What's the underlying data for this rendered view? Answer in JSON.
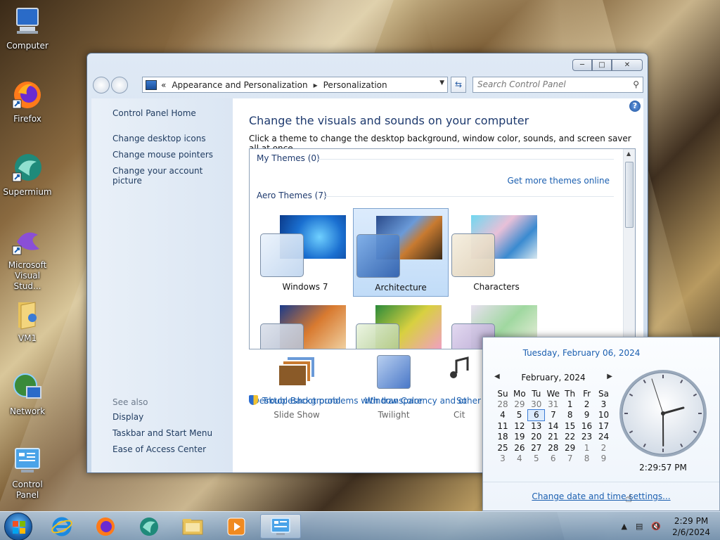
{
  "desktop": {
    "icons": [
      {
        "label": "Computer"
      },
      {
        "label": "Firefox"
      },
      {
        "label": "Supermium"
      },
      {
        "label": "Microsoft Visual Stud..."
      },
      {
        "label": "VM1"
      },
      {
        "label": "Network"
      },
      {
        "label": "Control Panel"
      }
    ]
  },
  "window": {
    "breadcrumb_prefix": "«",
    "breadcrumb": [
      "Appearance and Personalization",
      "Personalization"
    ],
    "search_placeholder": "Search Control Panel",
    "help": "?",
    "left_links": [
      "Control Panel Home",
      "Change desktop icons",
      "Change mouse pointers",
      "Change your account picture"
    ],
    "see_also_label": "See also",
    "see_also": [
      "Display",
      "Taskbar and Start Menu",
      "Ease of Access Center"
    ],
    "heading": "Change the visuals and sounds on your computer",
    "subheading": "Click a theme to change the desktop background, window color, sounds, and screen saver all at once.",
    "my_themes": "My Themes (0)",
    "get_more": "Get more themes online",
    "aero_themes": "Aero Themes (7)",
    "themes": [
      {
        "name": "Windows 7",
        "selected": false
      },
      {
        "name": "Architecture",
        "selected": true
      },
      {
        "name": "Characters",
        "selected": false
      }
    ],
    "bottom": [
      {
        "label": "Desktop Background",
        "sub": "Slide Show"
      },
      {
        "label": "Window Color",
        "sub": "Twilight"
      },
      {
        "label": "So",
        "sub": "Cit"
      }
    ],
    "troubleshoot": "Troubleshoot problems with transparency and other Aero e"
  },
  "flyout": {
    "long_date": "Tuesday, February 06, 2024",
    "month_label": "February, 2024",
    "weekdays": [
      "Su",
      "Mo",
      "Tu",
      "We",
      "Th",
      "Fr",
      "Sa"
    ],
    "weeks": [
      [
        "28",
        "29",
        "30",
        "31",
        "1",
        "2",
        "3"
      ],
      [
        "4",
        "5",
        "6",
        "7",
        "8",
        "9",
        "10"
      ],
      [
        "11",
        "12",
        "13",
        "14",
        "15",
        "16",
        "17"
      ],
      [
        "18",
        "19",
        "20",
        "21",
        "22",
        "23",
        "24"
      ],
      [
        "25",
        "26",
        "27",
        "28",
        "29",
        "1",
        "2"
      ],
      [
        "3",
        "4",
        "5",
        "6",
        "7",
        "8",
        "9"
      ]
    ],
    "time": "2:29:57 PM",
    "change_link": "Change date and time settings..."
  },
  "taskbar": {
    "time": "2:29 PM",
    "date": "2/6/2024"
  }
}
